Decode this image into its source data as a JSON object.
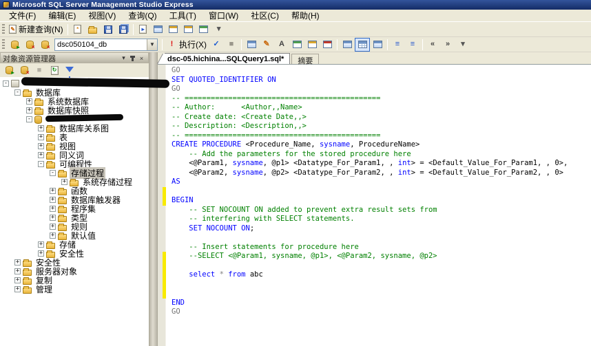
{
  "window": {
    "title": "Microsoft SQL Server Management Studio Express"
  },
  "menubar": {
    "items": [
      "文件(F)",
      "编辑(E)",
      "视图(V)",
      "查询(Q)",
      "工具(T)",
      "窗口(W)",
      "社区(C)",
      "帮助(H)"
    ]
  },
  "toolbar_standard": {
    "items": [
      {
        "t": "btn",
        "icon": "new-query",
        "label": "新建查询(N)"
      },
      {
        "t": "sep"
      },
      {
        "t": "btn",
        "icon": "new-page"
      },
      {
        "t": "btn",
        "icon": "open-folder"
      },
      {
        "t": "btn",
        "icon": "save"
      },
      {
        "t": "btn",
        "icon": "save-all"
      },
      {
        "t": "sep"
      },
      {
        "t": "btn",
        "icon": "page-arrow"
      },
      {
        "t": "btn",
        "icon": "window-grid"
      },
      {
        "t": "btn",
        "icon": "window-cascade"
      },
      {
        "t": "btn",
        "icon": "window-switch"
      },
      {
        "t": "btn",
        "icon": "window-export"
      },
      {
        "t": "overflow"
      }
    ]
  },
  "toolbar_sql": {
    "database_combo_value": "dsc050104_db",
    "execute_label": "执行(X)",
    "items": [
      {
        "t": "btn",
        "icon": "connect-db"
      },
      {
        "t": "btn",
        "icon": "disconnect-db"
      },
      {
        "t": "btn",
        "icon": "change-connection"
      },
      {
        "t": "combo"
      },
      {
        "t": "sep"
      },
      {
        "t": "btn",
        "icon": "execute-bang",
        "label": "执行(X)"
      },
      {
        "t": "btn",
        "icon": "parse-check"
      },
      {
        "t": "btn",
        "icon": "stop"
      },
      {
        "t": "sep"
      },
      {
        "t": "btn",
        "icon": "show-plan"
      },
      {
        "t": "btn",
        "icon": "design-query"
      },
      {
        "t": "btn",
        "icon": "template-params"
      },
      {
        "t": "btn",
        "icon": "analyze-dta"
      },
      {
        "t": "btn",
        "icon": "copy-window"
      },
      {
        "t": "btn",
        "icon": "red-window"
      },
      {
        "t": "sep"
      },
      {
        "t": "btn",
        "icon": "results-text"
      },
      {
        "t": "btn",
        "icon": "results-grid",
        "pressed": true
      },
      {
        "t": "btn",
        "icon": "results-file"
      },
      {
        "t": "sep"
      },
      {
        "t": "btn",
        "icon": "comment"
      },
      {
        "t": "btn",
        "icon": "uncomment"
      },
      {
        "t": "sep"
      },
      {
        "t": "btn",
        "icon": "indent-decrease"
      },
      {
        "t": "btn",
        "icon": "indent-increase"
      },
      {
        "t": "overflow"
      }
    ]
  },
  "object_explorer": {
    "title": "对象资源管理器",
    "toolbar_icons": [
      "connect-db",
      "disconnect-db",
      "stop-disabled",
      "refresh",
      "filter"
    ],
    "tree": [
      {
        "label": "",
        "level": 0,
        "exp": "minus",
        "icon": "server",
        "redacted": true
      },
      {
        "label": "数据库",
        "level": 1,
        "exp": "minus",
        "icon": "folder"
      },
      {
        "label": "系统数据库",
        "level": 2,
        "exp": "plus",
        "icon": "folder"
      },
      {
        "label": "数据库快照",
        "level": 2,
        "exp": "plus",
        "icon": "folder"
      },
      {
        "label": "",
        "level": 2,
        "exp": "minus",
        "icon": "db",
        "redacted": true
      },
      {
        "label": "数据库关系图",
        "level": 3,
        "exp": "plus",
        "icon": "folder"
      },
      {
        "label": "表",
        "level": 3,
        "exp": "plus",
        "icon": "folder"
      },
      {
        "label": "视图",
        "level": 3,
        "exp": "plus",
        "icon": "folder"
      },
      {
        "label": "同义词",
        "level": 3,
        "exp": "plus",
        "icon": "folder"
      },
      {
        "label": "可编程性",
        "level": 3,
        "exp": "minus",
        "icon": "folder"
      },
      {
        "label": "存储过程",
        "level": 4,
        "exp": "minus",
        "icon": "folder",
        "selected": true
      },
      {
        "label": "系统存储过程",
        "level": 5,
        "exp": "plus",
        "icon": "folder"
      },
      {
        "label": "函数",
        "level": 4,
        "exp": "plus",
        "icon": "folder"
      },
      {
        "label": "数据库触发器",
        "level": 4,
        "exp": "plus",
        "icon": "folder"
      },
      {
        "label": "程序集",
        "level": 4,
        "exp": "plus",
        "icon": "folder"
      },
      {
        "label": "类型",
        "level": 4,
        "exp": "plus",
        "icon": "folder"
      },
      {
        "label": "规则",
        "level": 4,
        "exp": "plus",
        "icon": "folder"
      },
      {
        "label": "默认值",
        "level": 4,
        "exp": "plus",
        "icon": "folder"
      },
      {
        "label": "存储",
        "level": 3,
        "exp": "plus",
        "icon": "folder"
      },
      {
        "label": "安全性",
        "level": 3,
        "exp": "plus",
        "icon": "folder"
      },
      {
        "label": "安全性",
        "level": 1,
        "exp": "plus",
        "icon": "folder"
      },
      {
        "label": "服务器对象",
        "level": 1,
        "exp": "plus",
        "icon": "folder"
      },
      {
        "label": "复制",
        "level": 1,
        "exp": "plus",
        "icon": "folder"
      },
      {
        "label": "管理",
        "level": 1,
        "exp": "plus",
        "icon": "folder"
      }
    ]
  },
  "editor": {
    "tabs": [
      {
        "label": "dsc-05.hichina...SQLQuery1.sql*",
        "active": true
      },
      {
        "label": "摘要",
        "active": false
      }
    ],
    "change_bars": [
      {
        "from": 14,
        "to": 15
      },
      {
        "from": 21,
        "to": 25
      }
    ],
    "code_lines": [
      [
        [
          "g",
          "GO"
        ]
      ],
      [
        [
          "k",
          "SET QUOTED_IDENTIFIER ON"
        ]
      ],
      [
        [
          "g",
          "GO"
        ]
      ],
      [
        [
          "c",
          "-- ============================================="
        ]
      ],
      [
        [
          "c",
          "-- Author:      <Author,,Name>"
        ]
      ],
      [
        [
          "c",
          "-- Create date: <Create Date,,>"
        ]
      ],
      [
        [
          "c",
          "-- Description: <Description,,>"
        ]
      ],
      [
        [
          "c",
          "-- ============================================="
        ]
      ],
      [
        [
          "k",
          "CREATE PROCEDURE"
        ],
        [
          "p",
          " <Procedure_Name, "
        ],
        [
          "k",
          "sysname"
        ],
        [
          "p",
          ", ProcedureName>"
        ]
      ],
      [
        [
          "p",
          "    "
        ],
        [
          "c",
          "-- Add the parameters for the stored procedure here"
        ]
      ],
      [
        [
          "p",
          "    <@Param1, "
        ],
        [
          "k",
          "sysname"
        ],
        [
          "p",
          ", @p1> <Datatype_For_Param1, , "
        ],
        [
          "k",
          "int"
        ],
        [
          "p",
          "> = <Default_Value_For_Param1, , 0>,"
        ]
      ],
      [
        [
          "p",
          "    <@Param2, "
        ],
        [
          "k",
          "sysname"
        ],
        [
          "p",
          ", @p2> <Datatype_For_Param2, , "
        ],
        [
          "k",
          "int"
        ],
        [
          "p",
          "> = <Default_Value_For_Param2, , 0>"
        ]
      ],
      [
        [
          "k",
          "AS"
        ]
      ],
      [],
      [
        [
          "k",
          "BEGIN"
        ]
      ],
      [
        [
          "p",
          "    "
        ],
        [
          "c",
          "-- SET NOCOUNT ON added to prevent extra result sets from"
        ]
      ],
      [
        [
          "p",
          "    "
        ],
        [
          "c",
          "-- interfering with SELECT statements."
        ]
      ],
      [
        [
          "p",
          "    "
        ],
        [
          "k",
          "SET NOCOUNT ON"
        ],
        [
          "p",
          ";"
        ]
      ],
      [],
      [
        [
          "p",
          "    "
        ],
        [
          "c",
          "-- Insert statements for procedure here"
        ]
      ],
      [
        [
          "p",
          "    "
        ],
        [
          "c",
          "--SELECT <@Param1, sysname, @p1>, <@Param2, sysname, @p2>"
        ]
      ],
      [],
      [
        [
          "p",
          "    "
        ],
        [
          "k",
          "select"
        ],
        [
          "p",
          " "
        ],
        [
          "o",
          "*"
        ],
        [
          "p",
          " "
        ],
        [
          "k",
          "from"
        ],
        [
          "p",
          " abc"
        ]
      ],
      [],
      [],
      [
        [
          "k",
          "END"
        ]
      ],
      [
        [
          "g",
          "GO"
        ]
      ]
    ]
  },
  "colors": {
    "keyword": "#0000ff",
    "comment": "#008000",
    "batch_separator": "#737373",
    "change_bar_yellow": "#f8ea00",
    "tree_selection_bg": "#c9c5ba"
  }
}
